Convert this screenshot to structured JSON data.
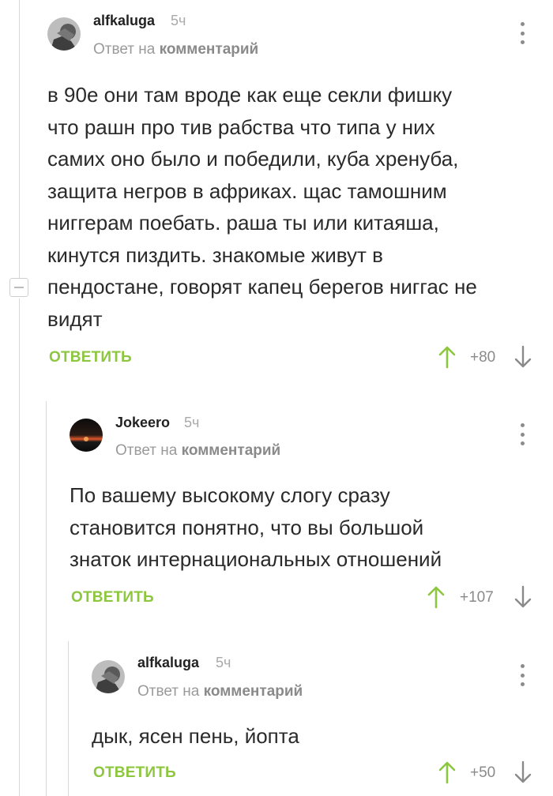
{
  "colors": {
    "accent_green": "#8dc63f",
    "muted_text": "#9a9a9a",
    "thread_line": "#d8d8d8"
  },
  "comments": [
    {
      "username": "alfkaluga",
      "time": "5ч",
      "reply_prefix": "Ответ на",
      "reply_target": "комментарий",
      "text": "в 90е они там вроде как еще секли фишку\nчто рашн про тив рабства что типа у них\nсамих оно было и победили, куба хренуба,\nзащита негров в африках. щас тамошним\nниггерам поебать. раша ты или китаяша,\nкинутся пиздить. знакомые живут в\nпендостане, говорят капец берегов ниггас не\nвидят",
      "reply_label": "ОТВЕТИТЬ",
      "rating": "+80",
      "avatar_icon": "user-avatar-icon"
    },
    {
      "username": "Jokeero",
      "time": "5ч",
      "reply_prefix": "Ответ на",
      "reply_target": "комментарий",
      "text": "По вашему высокому слогу сразу\nстановится понятно, что вы большой\nзнаток интернациональных отношений",
      "reply_label": "ОТВЕТИТЬ",
      "rating": "+107",
      "avatar_icon": "sunset-avatar-icon"
    },
    {
      "username": "alfkaluga",
      "time": "5ч",
      "reply_prefix": "Ответ на",
      "reply_target": "комментарий",
      "text": "дык, ясен пень, йопта",
      "reply_label": "ОТВЕТИТЬ",
      "rating": "+50",
      "avatar_icon": "user-avatar-icon"
    }
  ]
}
